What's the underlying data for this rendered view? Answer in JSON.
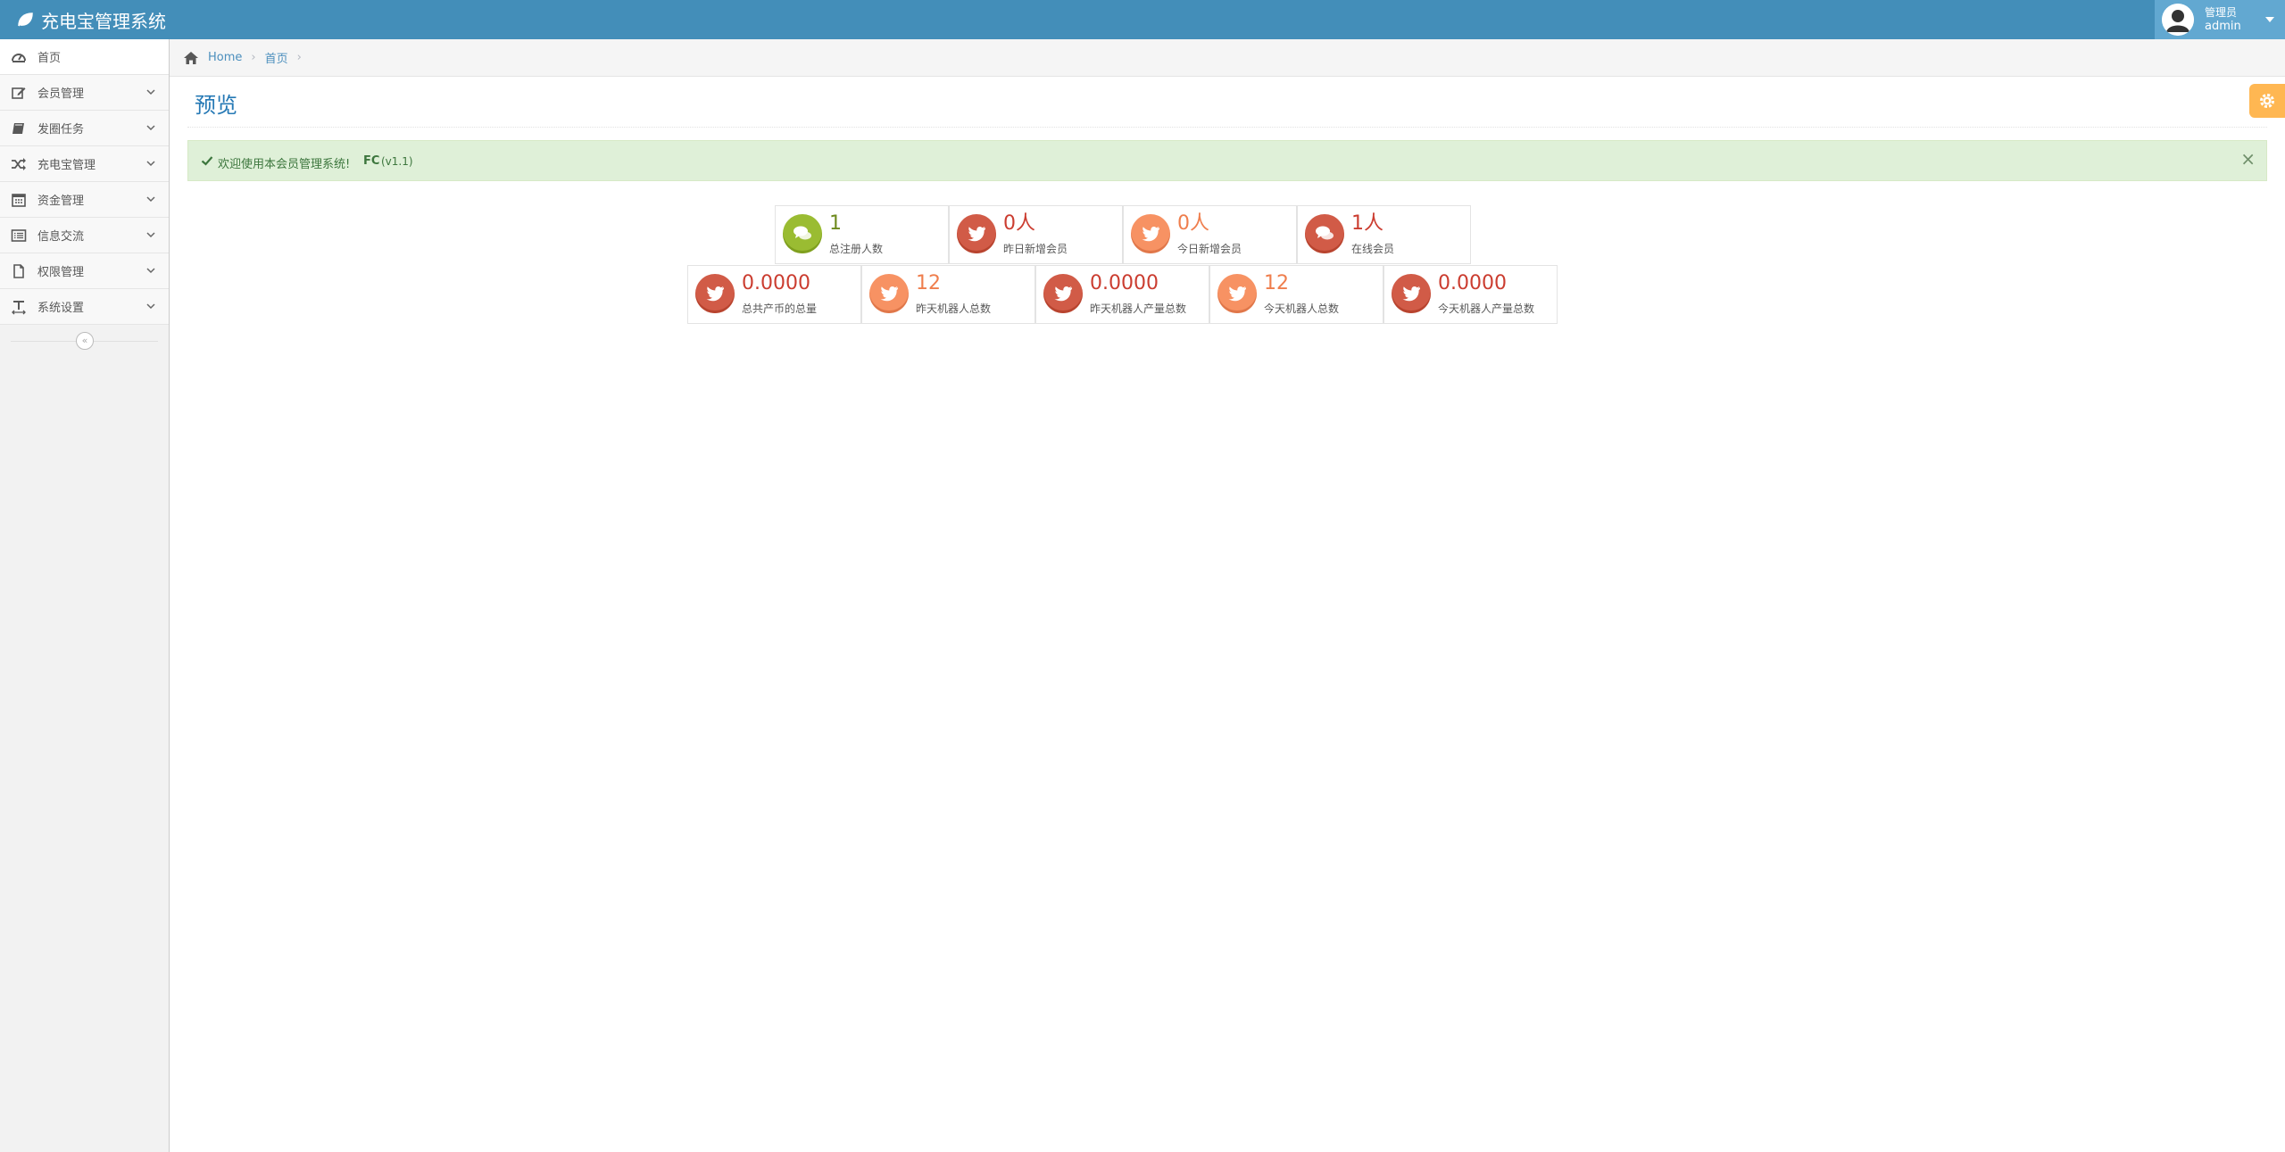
{
  "app": {
    "title": "充电宝管理系统"
  },
  "user": {
    "welcome": "管理员",
    "name": "admin"
  },
  "sidebar": {
    "items": [
      {
        "label": "首页",
        "icon": "dashboard-icon"
      },
      {
        "label": "会员管理",
        "icon": "edit-icon"
      },
      {
        "label": "发圈任务",
        "icon": "book-icon"
      },
      {
        "label": "充电宝管理",
        "icon": "shuffle-icon"
      },
      {
        "label": "资金管理",
        "icon": "calendar-icon"
      },
      {
        "label": "信息交流",
        "icon": "list-alt-icon"
      },
      {
        "label": "权限管理",
        "icon": "file-icon"
      },
      {
        "label": "系统设置",
        "icon": "text-width-icon"
      }
    ],
    "collapse_label": "«"
  },
  "breadcrumbs": {
    "home": "Home",
    "current": "首页",
    "separator": "›"
  },
  "page": {
    "title": "预览"
  },
  "alert": {
    "text": "欢迎使用本会员管理系统!",
    "strong": "FC",
    "small": "(v1.1)",
    "close": "×"
  },
  "stats_row1": [
    {
      "value": "1",
      "label": "总注册人数",
      "color": "green",
      "icon": "comments-icon"
    },
    {
      "value": "0人",
      "label": "昨日新增会员",
      "color": "red",
      "icon": "twitter-icon"
    },
    {
      "value": "0人",
      "label": "今日新增会员",
      "color": "orange",
      "icon": "twitter-icon"
    },
    {
      "value": "1人",
      "label": "在线会员",
      "color": "red",
      "icon": "comments-icon"
    }
  ],
  "stats_row2": [
    {
      "value": "0.0000",
      "label": "总共产币的总量",
      "color": "red",
      "icon": "twitter-icon"
    },
    {
      "value": "12",
      "label": "昨天机器人总数",
      "color": "orange",
      "icon": "twitter-icon"
    },
    {
      "value": "0.0000",
      "label": "昨天机器人产量总数",
      "color": "red",
      "icon": "twitter-icon"
    },
    {
      "value": "12",
      "label": "今天机器人总数",
      "color": "orange",
      "icon": "twitter-icon"
    },
    {
      "value": "0.0000",
      "label": "今天机器人产量总数",
      "color": "red",
      "icon": "twitter-icon"
    }
  ],
  "colors": {
    "navbar": "#438eb9",
    "green": "#9abc32",
    "red": "#d15b47",
    "orange": "#f79263",
    "alert_bg": "#dff0d8"
  }
}
